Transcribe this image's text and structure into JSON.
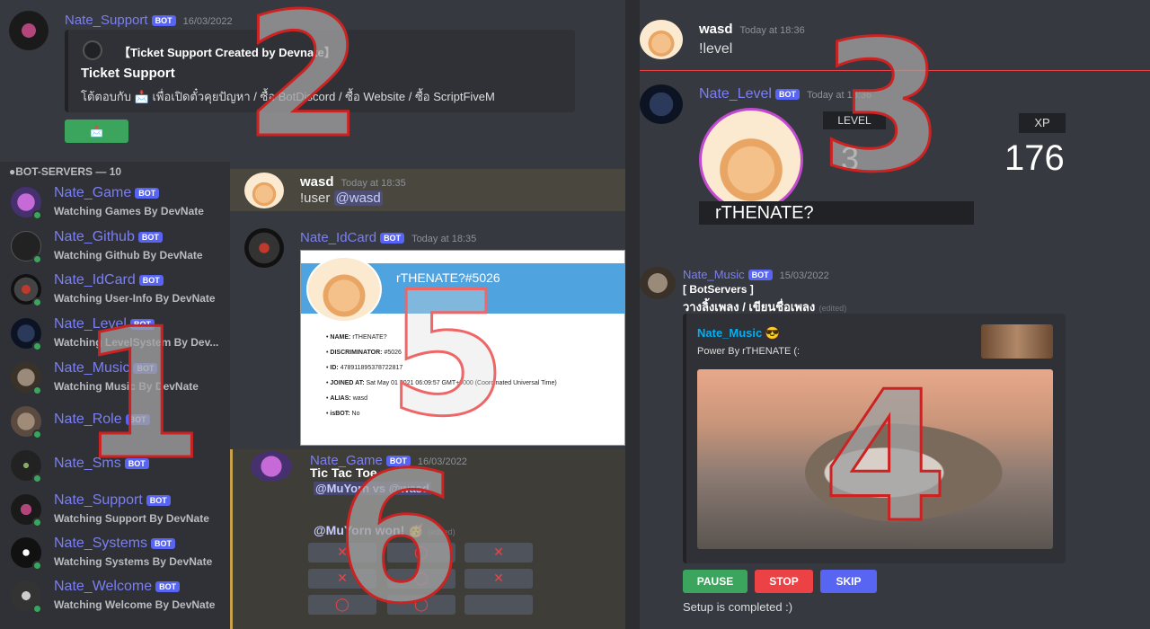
{
  "support": {
    "username": "Nate_Support",
    "bot_tag": "BOT",
    "timestamp": "16/03/2022",
    "embed_author": "【Ticket Support Created by Devnate】",
    "embed_title": "Ticket Support",
    "embed_desc": "โต้ตอบกับ 📩 เพื่อเปิดตั๋วคุยปัญหา / ซื้อ BotDiscord / ซื้อ Website / ซื้อ ScriptFiveM",
    "button_label": "📩"
  },
  "sidebar": {
    "header": "●BOT-SERVERS — 10",
    "items": [
      {
        "name": "Nate_Game",
        "status": "Watching Games By DevNate"
      },
      {
        "name": "Nate_Github",
        "status": "Watching Github By DevNate"
      },
      {
        "name": "Nate_IdCard",
        "status": "Watching User-Info By DevNate"
      },
      {
        "name": "Nate_Level",
        "status": "Watching LevelSystem By Dev..."
      },
      {
        "name": "Nate_Music",
        "status": "Watching Music By DevNate"
      },
      {
        "name": "Nate_Role",
        "status": ""
      },
      {
        "name": "Nate_Sms",
        "status": ""
      },
      {
        "name": "Nate_Support",
        "status": "Watching Support By DevNate"
      },
      {
        "name": "Nate_Systems",
        "status": "Watching Systems By DevNate"
      },
      {
        "name": "Nate_Welcome",
        "status": "Watching Welcome By DevNate"
      }
    ]
  },
  "idcard": {
    "user_name": "wasd",
    "user_ts": "Today at 18:35",
    "user_cmd": "!user",
    "user_mention": "@wasd",
    "bot_name": "Nate_IdCard",
    "bot_ts": "Today at 18:35",
    "card_title": "rTHENATE?#5026",
    "fields": [
      {
        "k": "NAME:",
        "v": "rTHENATE?"
      },
      {
        "k": "DISCRIMINATOR:",
        "v": "#5026"
      },
      {
        "k": "ID:",
        "v": "478911895378722817"
      },
      {
        "k": "JOINED AT:",
        "v": "Sat May 01 2021 06:09:57 GMT+0000 (Coordinated Universal Time)"
      },
      {
        "k": "ALIAS:",
        "v": "wasd"
      },
      {
        "k": "isBOT:",
        "v": "No"
      }
    ]
  },
  "game": {
    "bot_name": "Nate_Game",
    "ts": "16/03/2022",
    "title": "Tic Tac Toe",
    "vs": "@MuYorn vs @wasd",
    "result": "@MuYorn won! 🥳",
    "edited": "(edited)",
    "cells": [
      "✕",
      "◯",
      "✕",
      "✕",
      "◯",
      "✕",
      "◯",
      "◯",
      ""
    ]
  },
  "level": {
    "user_name": "wasd",
    "user_ts": "Today at 18:36",
    "user_cmd": "!level",
    "bot_name": "Nate_Level",
    "bot_ts": "Today at 18:36",
    "level_label": "LEVEL",
    "level_value": "3",
    "xp_label": "XP",
    "xp_value": "176",
    "card_name": "rTHENATE?"
  },
  "music": {
    "bot_name": "Nate_Music",
    "ts": "15/03/2022",
    "line1": "[ BotServers ]",
    "line2": "วางลิ้งเพลง / เขียนชื่อเพลง",
    "edited": "(edited)",
    "embed_title": "Nate_Music 😎",
    "embed_desc": "Power By rTHENATE (:",
    "pause": "PAUSE",
    "stop": "STOP",
    "skip": "SKIP",
    "footer": "Setup is completed :)"
  },
  "overlay_numbers": [
    "1",
    "2",
    "3",
    "4",
    "5",
    "6"
  ]
}
